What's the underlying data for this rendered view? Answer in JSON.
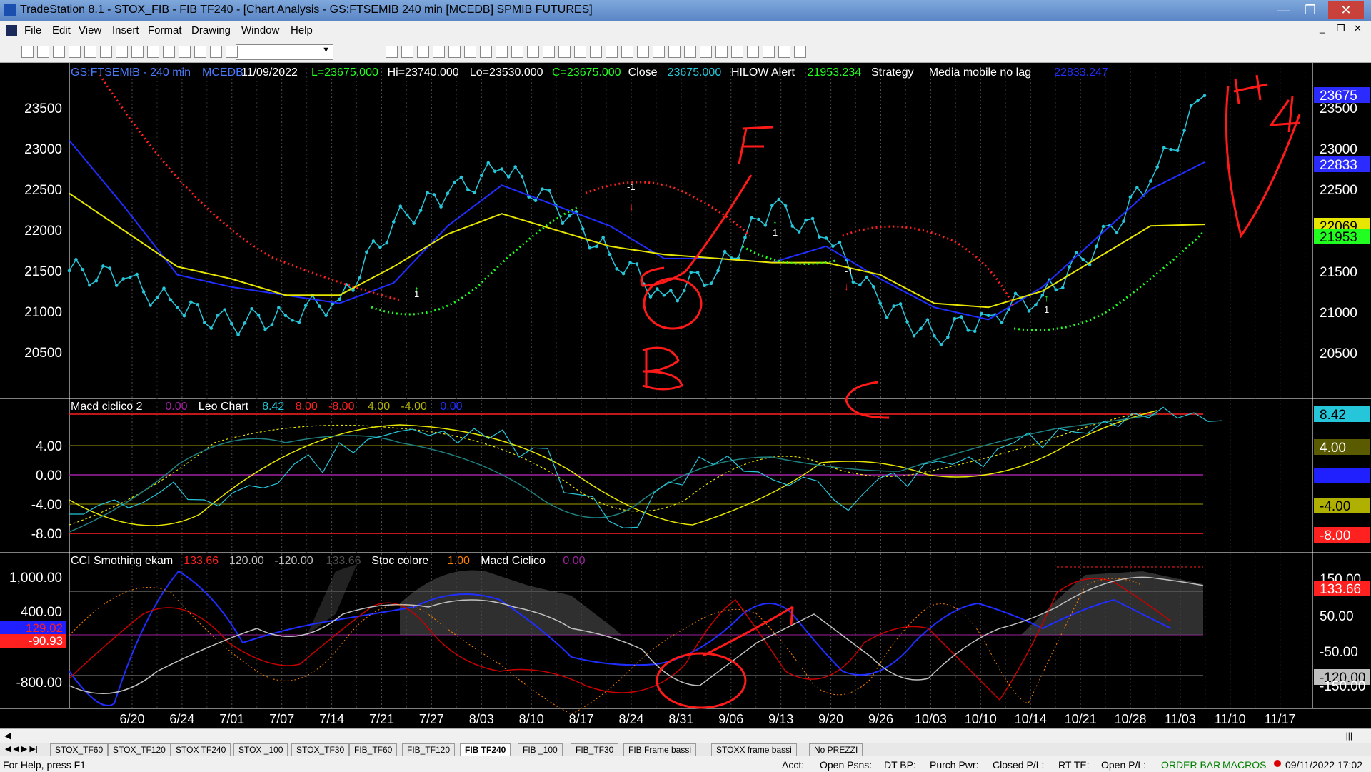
{
  "window": {
    "title": "TradeStation 8.1 - STOX_FIB - FIB TF240 - [Chart Analysis - GS:FTSEMIB  240 min  [MCEDB] SPMIB FUTURES]"
  },
  "menu": [
    "File",
    "Edit",
    "View",
    "Insert",
    "Format",
    "Drawing",
    "Window",
    "Help"
  ],
  "colors": {
    "price": "#26c6da",
    "sma_blue": "#1f2dff",
    "sma_yellow": "#e6e600",
    "hilow_red": "#ff2020",
    "hilow_green": "#20ff20",
    "annotation": "#ff1a1a",
    "grid": "#505050"
  },
  "price_panel": {
    "header": [
      {
        "text": "GS:FTSEMIB - 240 min",
        "color": "#4a7bff"
      },
      {
        "text": "MCEDB",
        "color": "#4a7bff"
      },
      {
        "text": "11/09/2022",
        "color": "#ffffff"
      },
      {
        "text": "L=23675.000",
        "color": "#20ff20"
      },
      {
        "text": "Hi=23740.000",
        "color": "#ffffff"
      },
      {
        "text": "Lo=23530.000",
        "color": "#ffffff"
      },
      {
        "text": "C=23675.000",
        "color": "#20ff20"
      },
      {
        "text": "Close",
        "color": "#ffffff"
      },
      {
        "text": "23675.000",
        "color": "#26c6da"
      },
      {
        "text": "HILOW Alert",
        "color": "#ffffff"
      },
      {
        "text": "21953.234",
        "color": "#20ff20"
      },
      {
        "text": "Strategy",
        "color": "#ffffff"
      },
      {
        "text": "Media mobile no lag",
        "color": "#ffffff"
      },
      {
        "text": "22833.247",
        "color": "#1f2dff"
      }
    ],
    "y_ticks": [
      "23500",
      "23000",
      "22500",
      "22000",
      "21500",
      "21000",
      "20500"
    ],
    "right_labels": [
      {
        "text": "23675",
        "bg": "#2b2bff",
        "fg": "#ffffff"
      },
      {
        "text": "23500",
        "bg": "",
        "fg": "#ffffff"
      },
      {
        "text": "23000",
        "bg": "",
        "fg": "#ffffff"
      },
      {
        "text": "22833",
        "bg": "#2b2bff",
        "fg": "#ffffff"
      },
      {
        "text": "22500",
        "bg": "",
        "fg": "#ffffff"
      },
      {
        "text": "22069",
        "bg": "#e6e600",
        "fg": "#000000"
      },
      {
        "text": "21953",
        "bg": "#20ff20",
        "fg": "#000000"
      },
      {
        "text": "21500",
        "bg": "",
        "fg": "#ffffff"
      },
      {
        "text": "21000",
        "bg": "",
        "fg": "#ffffff"
      },
      {
        "text": "20500",
        "bg": "",
        "fg": "#ffffff"
      }
    ],
    "signal_marks": [
      "1",
      "-1",
      "1",
      "-1",
      "1"
    ],
    "annotations": [
      "F",
      "B",
      "C",
      "H",
      "4"
    ]
  },
  "macd_panel": {
    "header": [
      {
        "text": "Macd ciclico 2",
        "color": "#ffffff"
      },
      {
        "text": "0.00",
        "color": "#a020a0"
      },
      {
        "text": "Leo Chart",
        "color": "#ffffff"
      },
      {
        "text": "8.42",
        "color": "#26c6da"
      },
      {
        "text": "8.00",
        "color": "#ff2020"
      },
      {
        "text": "-8.00",
        "color": "#ff2020"
      },
      {
        "text": "4.00",
        "color": "#b0b000"
      },
      {
        "text": "-4.00",
        "color": "#b0b000"
      },
      {
        "text": "0.00",
        "color": "#1f2dff"
      }
    ],
    "y_ticks": [
      "4.00",
      "0.00",
      "-4.00",
      "-8.00"
    ],
    "right_labels": [
      {
        "text": "8.42",
        "bg": "#26c6da",
        "fg": "#000000"
      },
      {
        "text": "4.00",
        "bg": "#5a5a00",
        "fg": "#ffffff"
      },
      {
        "text": "0.00",
        "bg": "#2020ff",
        "fg": "#2020ff"
      },
      {
        "text": "-4.00",
        "bg": "#b0b000",
        "fg": "#000000"
      },
      {
        "text": "-8.00",
        "bg": "#ff2020",
        "fg": "#ffffff"
      }
    ]
  },
  "cci_panel": {
    "header": [
      {
        "text": "CCI Smothing ekam",
        "color": "#ffffff"
      },
      {
        "text": "133.66",
        "color": "#ff2020"
      },
      {
        "text": "120.00",
        "color": "#c0c0c0"
      },
      {
        "text": "-120.00",
        "color": "#c0c0c0"
      },
      {
        "text": "133.66",
        "color": "#505050"
      },
      {
        "text": "Stoc colore",
        "color": "#ffffff"
      },
      {
        "text": "1.00",
        "color": "#ff8000"
      },
      {
        "text": "Macd Ciclico",
        "color": "#ffffff"
      },
      {
        "text": "0.00",
        "color": "#a020a0"
      }
    ],
    "y_ticks": [
      "1,000.00",
      "400.00",
      "-800.00"
    ],
    "left_badges": [
      {
        "text": "129.02",
        "bg": "#2020ff",
        "fg": "#ff2020"
      },
      {
        "text": "-90.93",
        "bg": "#ff2020",
        "fg": "#ffffff"
      }
    ],
    "right_labels": [
      {
        "text": "150.00",
        "bg": "",
        "fg": "#ffffff"
      },
      {
        "text": "133.66",
        "bg": "#ff2020",
        "fg": "#ffffff"
      },
      {
        "text": "50.00",
        "bg": "",
        "fg": "#ffffff"
      },
      {
        "text": "-50.00",
        "bg": "",
        "fg": "#ffffff"
      },
      {
        "text": "-120.00",
        "bg": "#c0c0c0",
        "fg": "#000000"
      },
      {
        "text": "-150.00",
        "bg": "",
        "fg": "#ffffff"
      }
    ]
  },
  "x_ticks": [
    "6/20",
    "6/24",
    "7/01",
    "7/07",
    "7/14",
    "7/21",
    "7/27",
    "8/03",
    "8/10",
    "8/17",
    "8/24",
    "8/31",
    "9/06",
    "9/13",
    "9/20",
    "9/26",
    "10/03",
    "10/10",
    "10/14",
    "10/21",
    "10/28",
    "11/03",
    "11/10",
    "11/17"
  ],
  "tabs": [
    "STOX_TF60",
    "STOX_TF120",
    "STOX TF240",
    "STOX _100",
    "STOX_TF30",
    "FIB_TF60",
    "FIB_TF120",
    "FIB TF240",
    "FIB _100",
    "FIB_TF30",
    "FIB Frame bassi",
    "STOXX frame bassi",
    "No PREZZI"
  ],
  "active_tab": "FIB TF240",
  "status": {
    "help": "For Help, press F1",
    "acct": "Acct:",
    "open_psns": "Open Psns:",
    "dt_bp": "DT BP:",
    "purch_pwr": "Purch Pwr:",
    "closed_pl": "Closed P/L:",
    "rt_te": "RT TE:",
    "open_pl": "Open P/L:",
    "order_bar": "ORDER BAR",
    "macros": "MACROS",
    "datetime": "09/11/2022 17:02"
  },
  "chart_data": {
    "type": "line",
    "title": "GS:FTSEMIB - 240 min",
    "xlabel": "",
    "ylabel": "",
    "categories": [
      "6/20",
      "6/24",
      "7/01",
      "7/07",
      "7/14",
      "7/21",
      "7/27",
      "8/03",
      "8/10",
      "8/17",
      "8/24",
      "8/31",
      "9/06",
      "9/13",
      "9/20",
      "9/26",
      "10/03",
      "10/10",
      "10/14",
      "10/21",
      "10/28",
      "11/03"
    ],
    "ylim": [
      20000,
      23800
    ],
    "series": [
      {
        "values": [
          21500,
          21400,
          21050,
          20850,
          20950,
          21150,
          22100,
          22450,
          22750,
          22300,
          21700,
          21200,
          21500,
          22300,
          21900,
          21100,
          20700,
          20950,
          21200,
          21800,
          22600,
          23650
        ]
      },
      {
        "values": [
          23100,
          22300,
          21450,
          21300,
          21200,
          21100,
          21350,
          22050,
          22550,
          22300,
          22050,
          21650,
          21650,
          21600,
          21800,
          21400,
          21050,
          20900,
          21300,
          21900,
          22500,
          22833
        ]
      },
      {
        "values": [
          22450,
          22000,
          21550,
          21400,
          21200,
          21200,
          21550,
          21950,
          22200,
          22000,
          21800,
          21700,
          21650,
          21600,
          21600,
          21450,
          21100,
          21050,
          21250,
          21650,
          22050,
          22069
        ]
      }
    ]
  }
}
